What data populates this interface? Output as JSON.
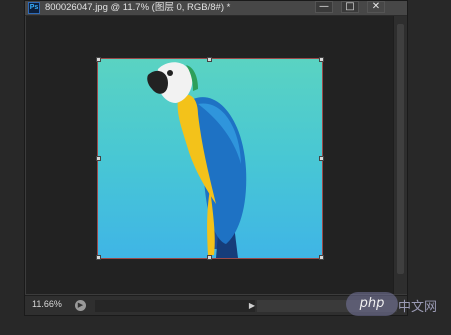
{
  "window": {
    "app_icon": "Ps",
    "title": "800026047.jpg @ 11.7% (图层 0, RGB/8#) *",
    "minimize_label": "—",
    "maximize_label": "□",
    "close_label": "✕"
  },
  "statusbar": {
    "zoom": "11.66%",
    "arrow_label": "▶",
    "right_arrow": "▶"
  },
  "watermark": {
    "badge": "php",
    "text": "中文网"
  },
  "colors": {
    "canvas_bg": "#222222",
    "image_top": "#5ad3c2",
    "image_bottom": "#3fb5e6",
    "parrot_blue": "#1e72c4",
    "parrot_yellow": "#f3c21a"
  }
}
